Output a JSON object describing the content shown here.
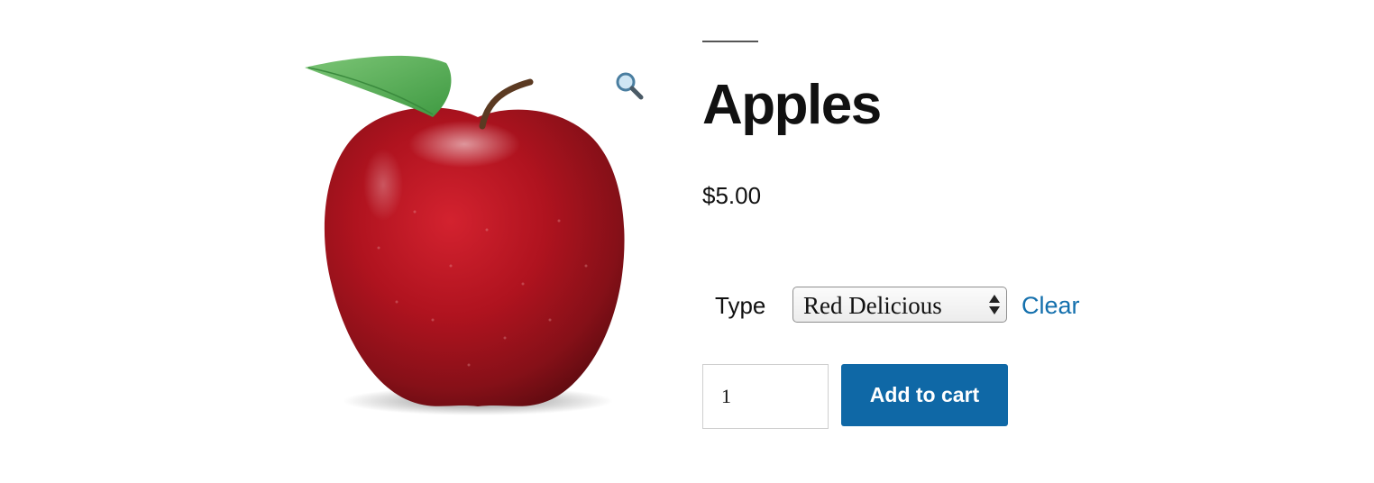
{
  "product": {
    "title": "Apples",
    "price": "$5.00"
  },
  "gallery": {
    "zoom_icon": "magnifying-glass-icon",
    "image_subject": "red-apple-image"
  },
  "variation": {
    "label": "Type",
    "selected": "Red Delicious",
    "clear_label": "Clear"
  },
  "cart": {
    "quantity": "1",
    "add_label": "Add to cart"
  },
  "colors": {
    "button": "#0f68a6",
    "link": "#1470ad",
    "text": "#111111"
  }
}
